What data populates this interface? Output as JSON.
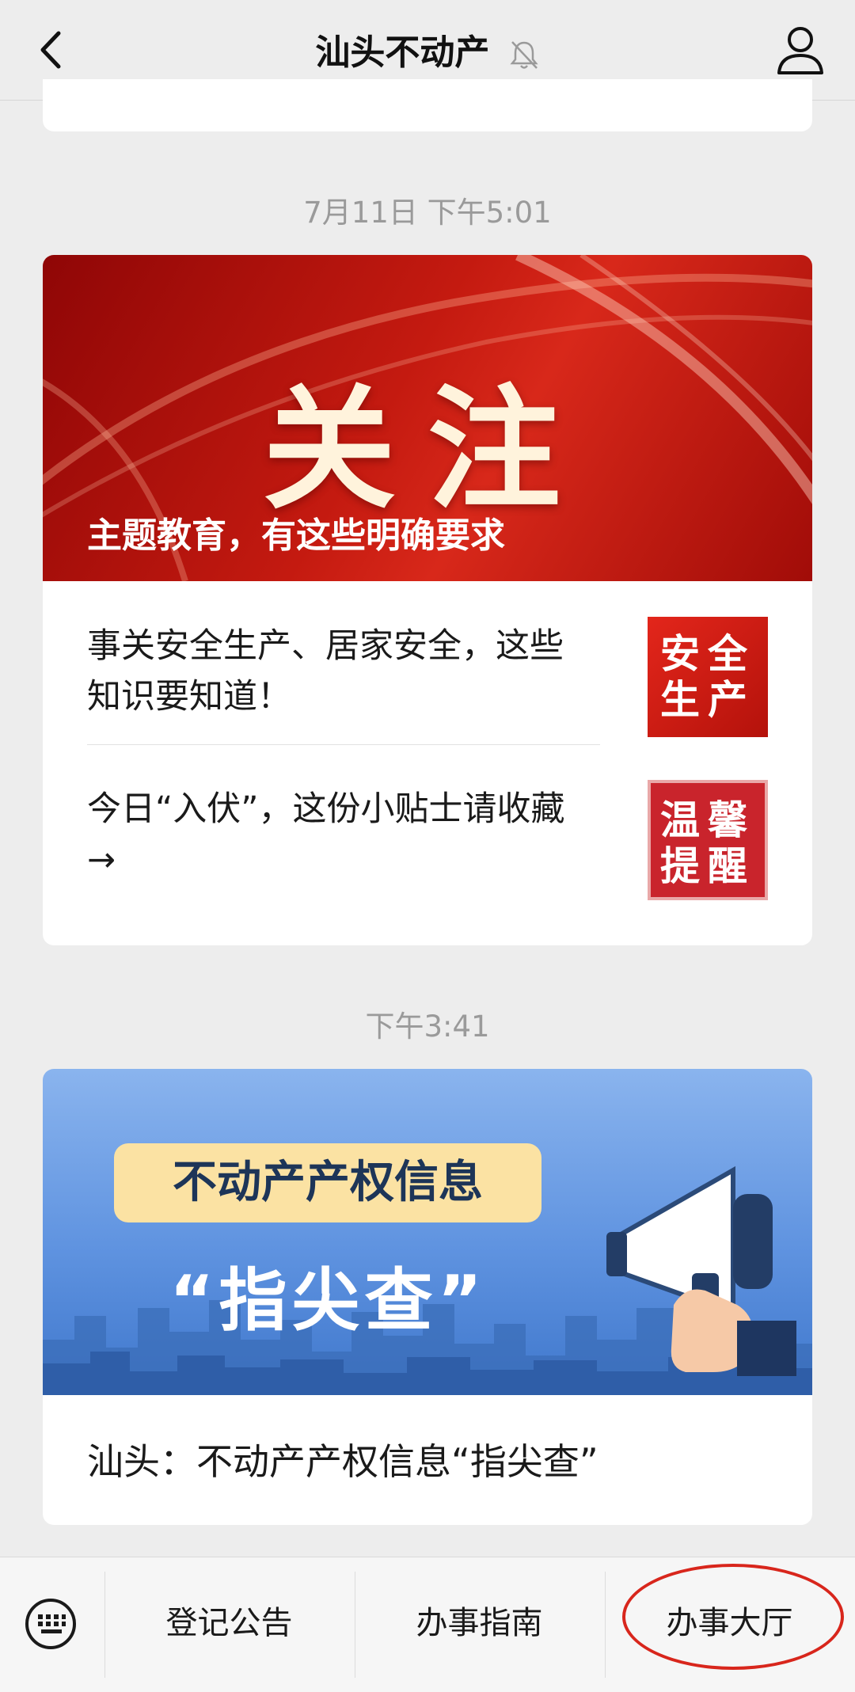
{
  "header": {
    "title": "汕头不动产",
    "icons": {
      "back": "back-chevron-icon",
      "mute": "bell-muted-icon",
      "profile": "person-icon"
    }
  },
  "messages": [
    {
      "timestamp": "7月11日 下午5:01",
      "main": {
        "banner_big": "关注",
        "banner_sub": "主题教育，有这些明确要求"
      },
      "subitems": [
        {
          "title": "事关安全生产、居家安全，这些知识要知道！",
          "thumb_text": "安全生产"
        },
        {
          "title": "今日“入伏”，这份小贴士请收藏 →",
          "thumb_text": "温馨提醒"
        }
      ]
    },
    {
      "timestamp": "下午3:41",
      "banner_box": "不动产产权信息",
      "banner_quote": "“指尖查”",
      "title": "汕头：不动产产权信息“指尖查”"
    }
  ],
  "menu": {
    "keyboard_icon": "keyboard-icon",
    "items": [
      "登记公告",
      "办事指南",
      "办事大厅"
    ],
    "highlight_color": "#d8261c"
  },
  "colors": {
    "background": "#ededed",
    "banner_red": "#c41a10",
    "banner_blue": "#5f93e0"
  }
}
